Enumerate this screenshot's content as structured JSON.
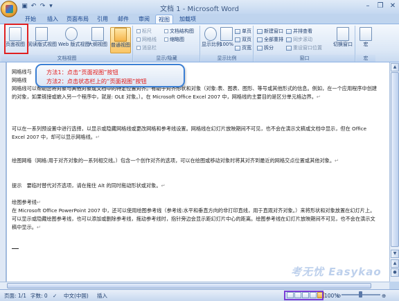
{
  "app": {
    "title": "文档 1 - Microsoft Word",
    "qat_icons": [
      "save-icon",
      "undo-icon",
      "redo-icon",
      "customize-qat-icon"
    ],
    "window_controls": [
      "minimize-icon",
      "restore-icon",
      "close-icon"
    ]
  },
  "tabs": [
    {
      "label": "开始",
      "active": false
    },
    {
      "label": "插入",
      "active": false
    },
    {
      "label": "页面布局",
      "active": false
    },
    {
      "label": "引用",
      "active": false
    },
    {
      "label": "邮件",
      "active": false
    },
    {
      "label": "审阅",
      "active": false
    },
    {
      "label": "视图",
      "active": true
    },
    {
      "label": "加载项",
      "active": false
    }
  ],
  "ribbon": {
    "doc_views": {
      "group_label": "文档视图",
      "buttons": [
        {
          "label": "页面视图",
          "selected": false
        },
        {
          "label": "阅读版式视图",
          "selected": false
        },
        {
          "label": "Web 版式视图",
          "selected": false
        },
        {
          "label": "大纲视图",
          "selected": false
        },
        {
          "label": "普通视图",
          "selected": true
        }
      ]
    },
    "show_hide": {
      "group_label": "显示/隐藏",
      "items": [
        "标尺",
        "网格线",
        "消息栏",
        "文档结构图",
        "缩略图"
      ]
    },
    "zoom": {
      "group_label": "显示比例",
      "buttons": [
        "显示比例",
        "100%"
      ],
      "small": [
        "单页",
        "双页",
        "页宽"
      ]
    },
    "window": {
      "group_label": "窗口",
      "left": [
        "新建窗口",
        "全部重排",
        "拆分"
      ],
      "right": [
        "并排查看",
        "同步滚动",
        "重设窗口位置"
      ],
      "switch": "切换窗口"
    },
    "macro": {
      "group_label": "宏",
      "button": "宏"
    }
  },
  "callout": {
    "line1": "方法1：点击“页面视图”按钮",
    "line2": "方法2：点击状态栏上的“页面视图”按钮"
  },
  "document": {
    "line_a": "网格线与",
    "line_b": "网格线",
    "p1": "网格线可以帮助您将对象与其他对象或文档中的特定位置对齐。有助于对齐形状和对象（对象:表、图表、图形、等号或其他形式的信息。例如，在一个应用程序中创建的对象，如果链接或嵌入另一个程序中，就是: OLE 对象。）。在 Microsoft Office Excel 2007 中，网格线的主要目的是区分单元格边界。",
    "p2": "可以在一系列预设置中进行选择，以显示或隐藏网格线或更改网格和参考线设置。网格线在幻灯片放映期间不可见，也不会在演示文稿或文档中显示，但在 Office Excel 2007 中，却可以显示网格线。",
    "p3": "绘图网格（网格:用于对齐对象的一系列相交线。）包含一个创作对齐的选项，可以在绘图或移动对象时将其对齐到最近的网格交点位置或其他对象。",
    "p4": "提示　要临时替代对齐选项，请在拖住 Alt 的同时拖动形状或对象。",
    "p5_title": "绘图参考线",
    "p5": "在 Microsoft Office PowerPoint 2007 中，还可以使用绘图参考线（参考线:水平和垂直方向的非打印直线，用于直观对齐对象。）来将形状和对象放置在幻灯片上。可以显示或隐藏绘图参考线，也可以添加或删除参考线，拖动参考线时，指针旁边会显示距幻灯片中心的距离。绘图参考线在幻灯片放映期间不可见，也不会在演示文稿中显示。",
    "para_mark": "↵"
  },
  "statusbar": {
    "page": "页面: 1/1",
    "words": "字数: 0",
    "lang": "中文(中国)",
    "mode": "插入",
    "zoom": "100%",
    "view_buttons": [
      "page-view",
      "reading-view",
      "web-view",
      "outline-view",
      "draft-view"
    ],
    "active_view_index": 4
  },
  "watermark": "考无忧 Easykao",
  "colors": {
    "accent": "#3b7fd4",
    "callout_text": "#e01b1b",
    "highlight_box": "#e02020",
    "status_highlight": "#7a3fd6"
  }
}
